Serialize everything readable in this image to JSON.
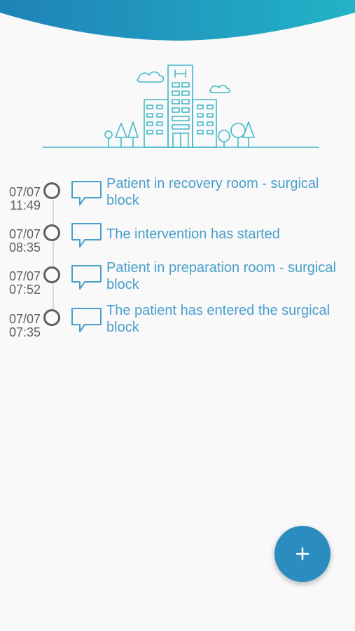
{
  "header": {
    "accent_start": "#1f82b8",
    "accent_end": "#22b3c6",
    "illustration_color": "#41b8c7"
  },
  "timeline": {
    "items": [
      {
        "date": "07/07",
        "time": "11:49",
        "text": "Patient in recovery room - surgical block"
      },
      {
        "date": "07/07",
        "time": "08:35",
        "text": "The intervention has started"
      },
      {
        "date": "07/07",
        "time": "07:52",
        "text": "Patient in preparation room - surgical block"
      },
      {
        "date": "07/07",
        "time": "07:35",
        "text": "The patient has entered the surgical block"
      }
    ]
  },
  "fab": {
    "icon": "plus-icon",
    "color": "#2a8cbf"
  }
}
